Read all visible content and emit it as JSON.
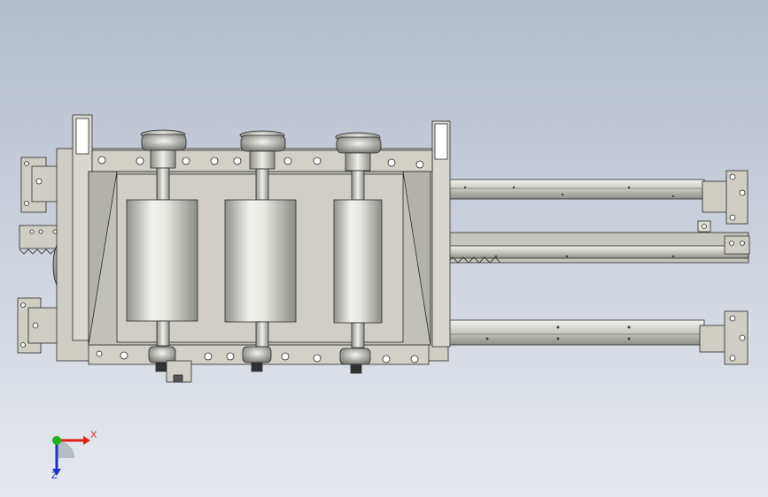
{
  "view": {
    "background_top": "#b4bccb",
    "background_bottom": "#e6e9ef",
    "part_fill": "#c9c9c1",
    "part_fill_light": "#dedbd2",
    "part_edge": "#2a2a2a",
    "roller_fill_dark": "#8f918b",
    "roller_fill_light": "#f2f2ee"
  },
  "triad": {
    "x_label": "X",
    "z_label": "Z",
    "x_color": "#e0201b",
    "y_color": "#1bb31b",
    "z_color": "#2030d0"
  },
  "assembly": {
    "rollers": 3,
    "rails": 3
  }
}
